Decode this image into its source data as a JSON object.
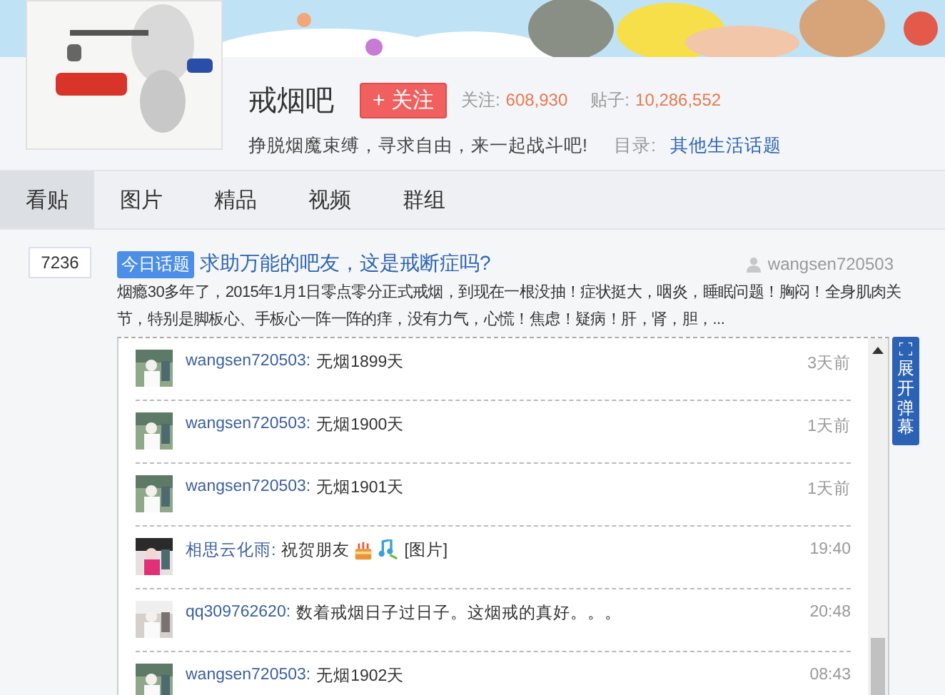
{
  "forum": {
    "name": "戒烟吧",
    "follow_button": "+ 关注",
    "stats": [
      {
        "label": "关注:",
        "value": "608,930"
      },
      {
        "label": "贴子:",
        "value": "10,286,552"
      }
    ],
    "slogan": "挣脱烟魔束缚，寻求自由，来一起战斗吧!",
    "directory_label": "目录:",
    "directory_link": "其他生活话题"
  },
  "tabs": [
    {
      "label": "看贴",
      "selected": true
    },
    {
      "label": "图片",
      "selected": false
    },
    {
      "label": "精品",
      "selected": false
    },
    {
      "label": "视频",
      "selected": false
    },
    {
      "label": "群组",
      "selected": false
    }
  ],
  "post": {
    "reply_count": "7236",
    "badge": "今日话题",
    "title": "求助万能的吧友，这是戒断症吗?",
    "author": "wangsen720503",
    "excerpt": "烟瘾30多年了，2015年1月1日零点零分正式戒烟，到现在一根没抽！症状挺大，咽炎，睡眠问题！胸闷！全身肌肉关节，特别是脚板心、手板心一阵一阵的痒，没有力气，心慌！焦虑！疑病！肝，肾，胆，..."
  },
  "comments": [
    {
      "user": "wangsen720503:",
      "text": "无烟1899天",
      "time": "3天前"
    },
    {
      "user": "wangsen720503:",
      "text": "无烟1900天",
      "time": "1天前"
    },
    {
      "user": "wangsen720503:",
      "text": "无烟1901天",
      "time": "1天前"
    },
    {
      "user": "相思云化雨:",
      "text": "祝贺朋友",
      "emoticons": [
        {
          "kind": "cake"
        },
        {
          "kind": "music"
        }
      ],
      "attachment": "[图片]",
      "time": "19:40"
    },
    {
      "user": "qq309762620:",
      "text": "数着戒烟日子过日子。这烟戒的真好。。。",
      "time": "20:48"
    },
    {
      "user": "wangsen720503:",
      "text": "无烟1902天",
      "time": "08:43"
    }
  ],
  "expand_button": "展开弹幕"
}
